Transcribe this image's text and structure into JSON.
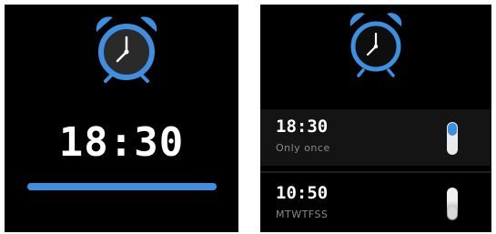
{
  "colors": {
    "accent": "#3f8fe0",
    "background": "#000000",
    "text": "#ffffff",
    "subtext": "#8a8a8a"
  },
  "left_screen": {
    "icon": "alarm-clock-icon",
    "time": "18:30"
  },
  "right_screen": {
    "icon": "alarm-clock-icon",
    "alarms": [
      {
        "time": "18:30",
        "repeat": "Only once",
        "enabled": true
      },
      {
        "time": "10:50",
        "repeat": "MTWTFSS",
        "enabled": false
      }
    ]
  }
}
